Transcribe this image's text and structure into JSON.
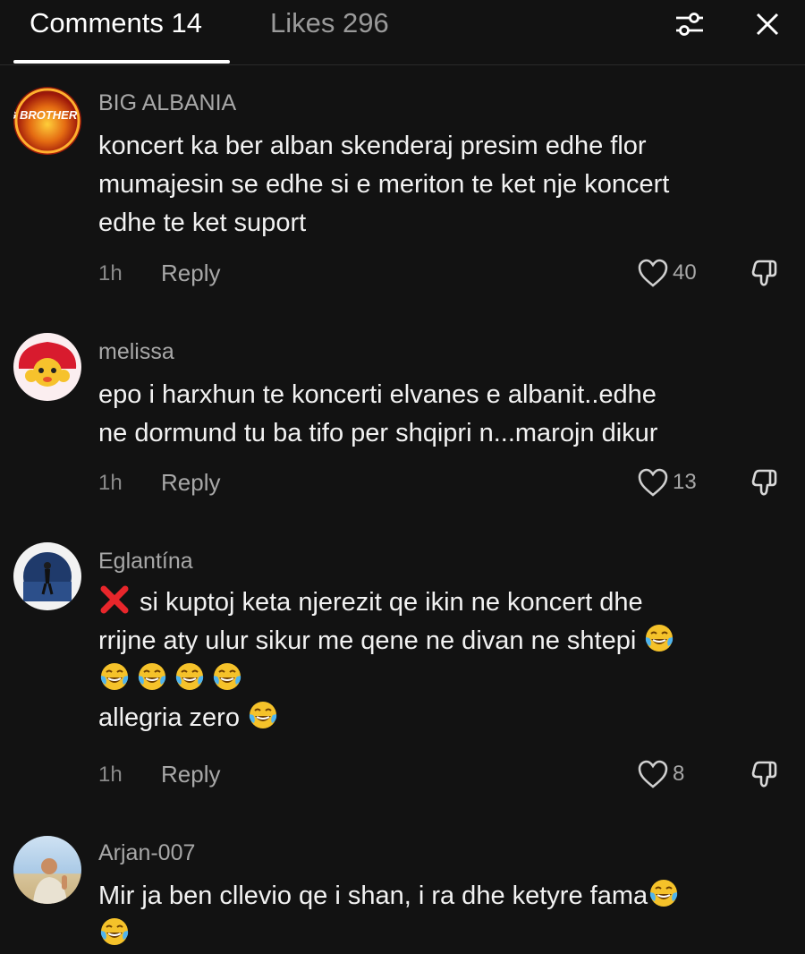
{
  "header": {
    "comments_tab": "Comments 14",
    "likes_tab": "Likes 296",
    "filter_icon": "sliders-icon",
    "close_icon": "close-icon"
  },
  "comments": [
    {
      "username": "BIG ALBANIA",
      "avatar_text": "BIG BROTHER VIP",
      "lines": [
        "koncert ka ber alban skenderaj presim edhe flor",
        "mumajesin se edhe si e meriton te ket nje koncert",
        "edhe te ket suport"
      ],
      "time": "1h",
      "reply": "Reply",
      "likes": "40"
    },
    {
      "username": "melissa",
      "lines": [
        "epo i harxhun te koncerti elvanes e albanit..edhe",
        "ne dormund tu ba tifo per shqipri n...marojn dikur"
      ],
      "time": "1h",
      "reply": "Reply",
      "likes": "13"
    },
    {
      "username": "Eglantína",
      "lines": [
        "si kuptoj keta njerezit qe ikin ne koncert dhe",
        "rrijne aty ulur sikur me qene ne divan ne shtepi",
        "",
        "allegria zero"
      ],
      "time": "1h",
      "reply": "Reply",
      "likes": "8"
    },
    {
      "username": "Arjan-007",
      "lines": [
        "Mir ja ben cllevio qe i shan, i ra dhe ketyre fama"
      ]
    }
  ],
  "colors": {
    "background": "#121212",
    "text": "#f2f2f2",
    "muted": "#a8a8a8",
    "emoji_yellow": "#f5c22a",
    "x_red": "#e8262b"
  }
}
